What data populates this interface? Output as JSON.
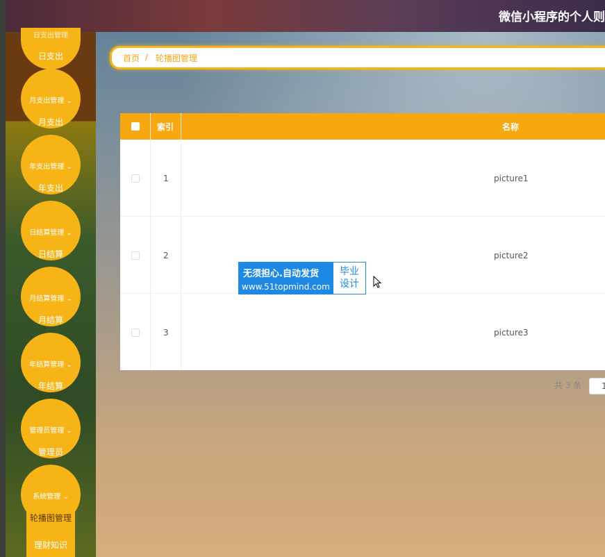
{
  "header": {
    "title": "微信小程序的个人则"
  },
  "sidebar": {
    "top_child": "日支出",
    "top_partial": "日支出管理",
    "items": [
      {
        "parent": "月支出管理",
        "child": "月支出"
      },
      {
        "parent": "年支出管理",
        "child": "年支出"
      },
      {
        "parent": "日结算管理",
        "child": "日结算"
      },
      {
        "parent": "月结算管理",
        "child": "月结算"
      },
      {
        "parent": "年结算管理",
        "child": "年结算"
      },
      {
        "parent": "管理员管理",
        "child": "管理员"
      },
      {
        "parent": "系统管理",
        "child": "轮播图管理"
      }
    ],
    "extra_child": "理财知识"
  },
  "breadcrumb": {
    "home": "首页",
    "sep": "/",
    "current": "轮播图管理"
  },
  "table": {
    "headers": {
      "index": "索引",
      "name": "名称"
    },
    "rows": [
      {
        "index": "1",
        "name": "picture1"
      },
      {
        "index": "2",
        "name": "picture2"
      },
      {
        "index": "3",
        "name": "picture3"
      }
    ]
  },
  "ad": {
    "line1": "无须担心.自动发货",
    "line2": "www.51topmind.com",
    "right1": "毕业",
    "right2": "设计"
  },
  "pager": {
    "total": "共 3 条",
    "page": "1"
  }
}
